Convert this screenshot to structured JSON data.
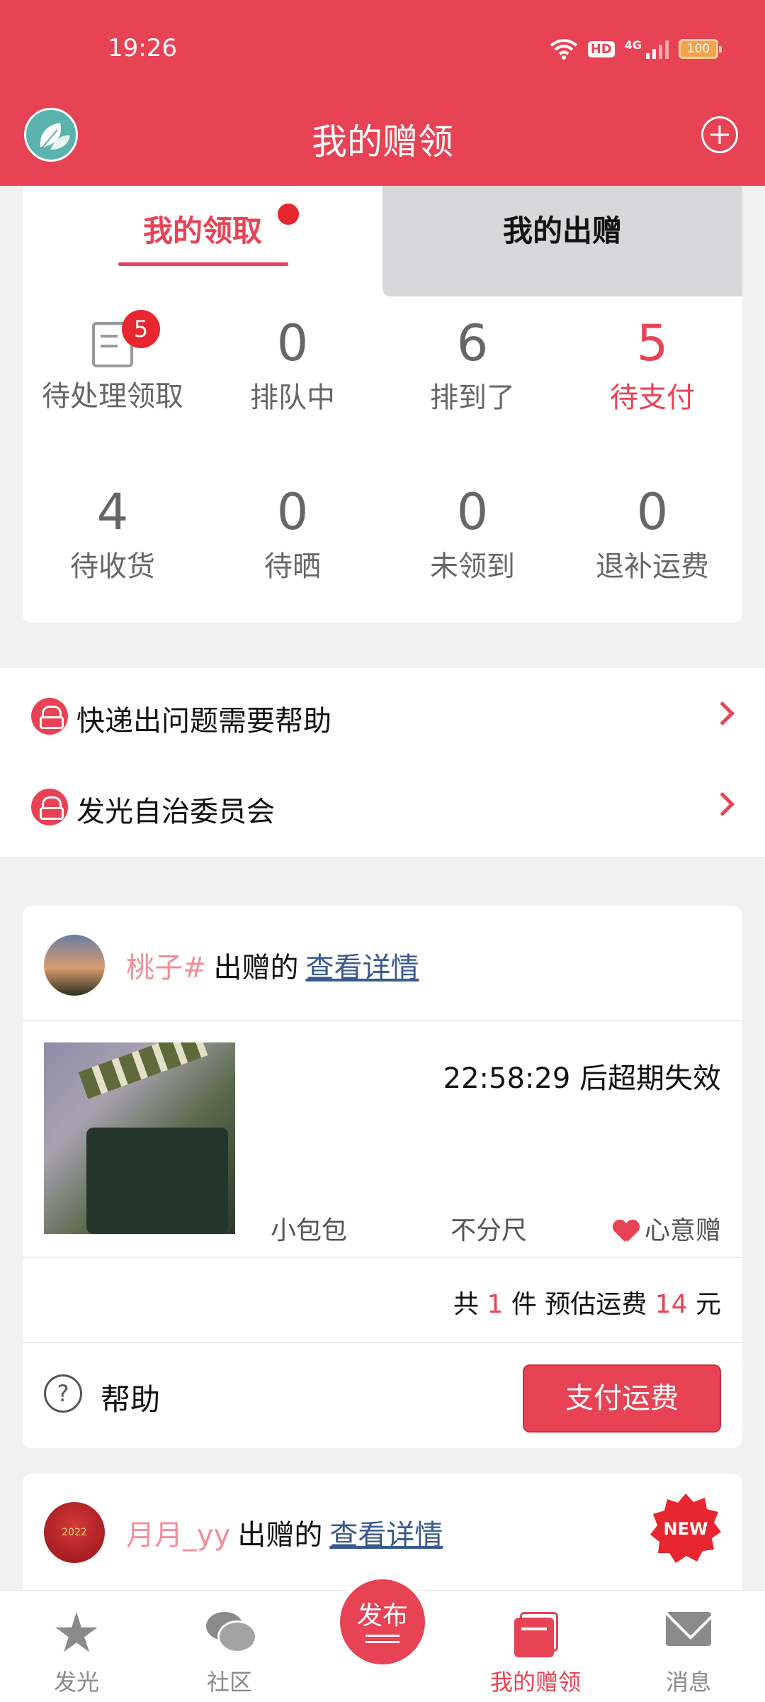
{
  "status_bar": {
    "time": "19:26",
    "hd": "HD",
    "network": "4G",
    "battery": "100",
    "icons": [
      "wifi-icon",
      "hd-icon",
      "signal-icon",
      "battery-icon"
    ]
  },
  "header": {
    "title": "我的赠领",
    "avatar_icon": "leaf-avatar-icon",
    "action_icon": "plus-circle-icon",
    "color": "#e84355"
  },
  "tabs": [
    {
      "label": "我的领取",
      "active": true,
      "has_dot": true
    },
    {
      "label": "我的出赠",
      "active": false
    }
  ],
  "stats_row1": [
    {
      "value": "",
      "label": "待处理领取",
      "badge": "5",
      "icon": "document-pending-icon"
    },
    {
      "value": "0",
      "label": "排队中"
    },
    {
      "value": "6",
      "label": "排到了"
    },
    {
      "value": "5",
      "label": "待支付",
      "highlight": true
    }
  ],
  "stats_row2": [
    {
      "value": "4",
      "label": "待收货"
    },
    {
      "value": "0",
      "label": "待晒"
    },
    {
      "value": "0",
      "label": "未领到"
    },
    {
      "value": "0",
      "label": "退补运费"
    }
  ],
  "help_links": [
    {
      "label": "快递出问题需要帮助",
      "icon": "support-agent-icon"
    },
    {
      "label": "发光自治委员会",
      "icon": "support-agent-icon"
    }
  ],
  "orders": [
    {
      "giver_name": "桃子#",
      "action": "出赠的",
      "link": "查看详情",
      "countdown": "22:58:29 后超期失效",
      "item_name": "小包包",
      "size": "不分尺",
      "tag": "心意赠",
      "totals": {
        "prefix": "共",
        "count": "1",
        "mid": "件 预估运费",
        "fee": "14",
        "suffix": "元"
      },
      "help_label": "帮助",
      "pay_label": "支付运费"
    },
    {
      "giver_name": "月月_yy",
      "action": "出赠的",
      "link": "查看详情",
      "avatar_text": "2022",
      "badge": "NEW"
    }
  ],
  "bottom_nav": [
    {
      "label": "发光",
      "icon": "star-icon"
    },
    {
      "label": "社区",
      "icon": "chat-bubbles-icon"
    },
    {
      "label": "发布",
      "icon": "publish-icon",
      "center": true
    },
    {
      "label": "我的赠领",
      "icon": "book-icon",
      "active": true
    },
    {
      "label": "消息",
      "icon": "mail-icon"
    }
  ]
}
